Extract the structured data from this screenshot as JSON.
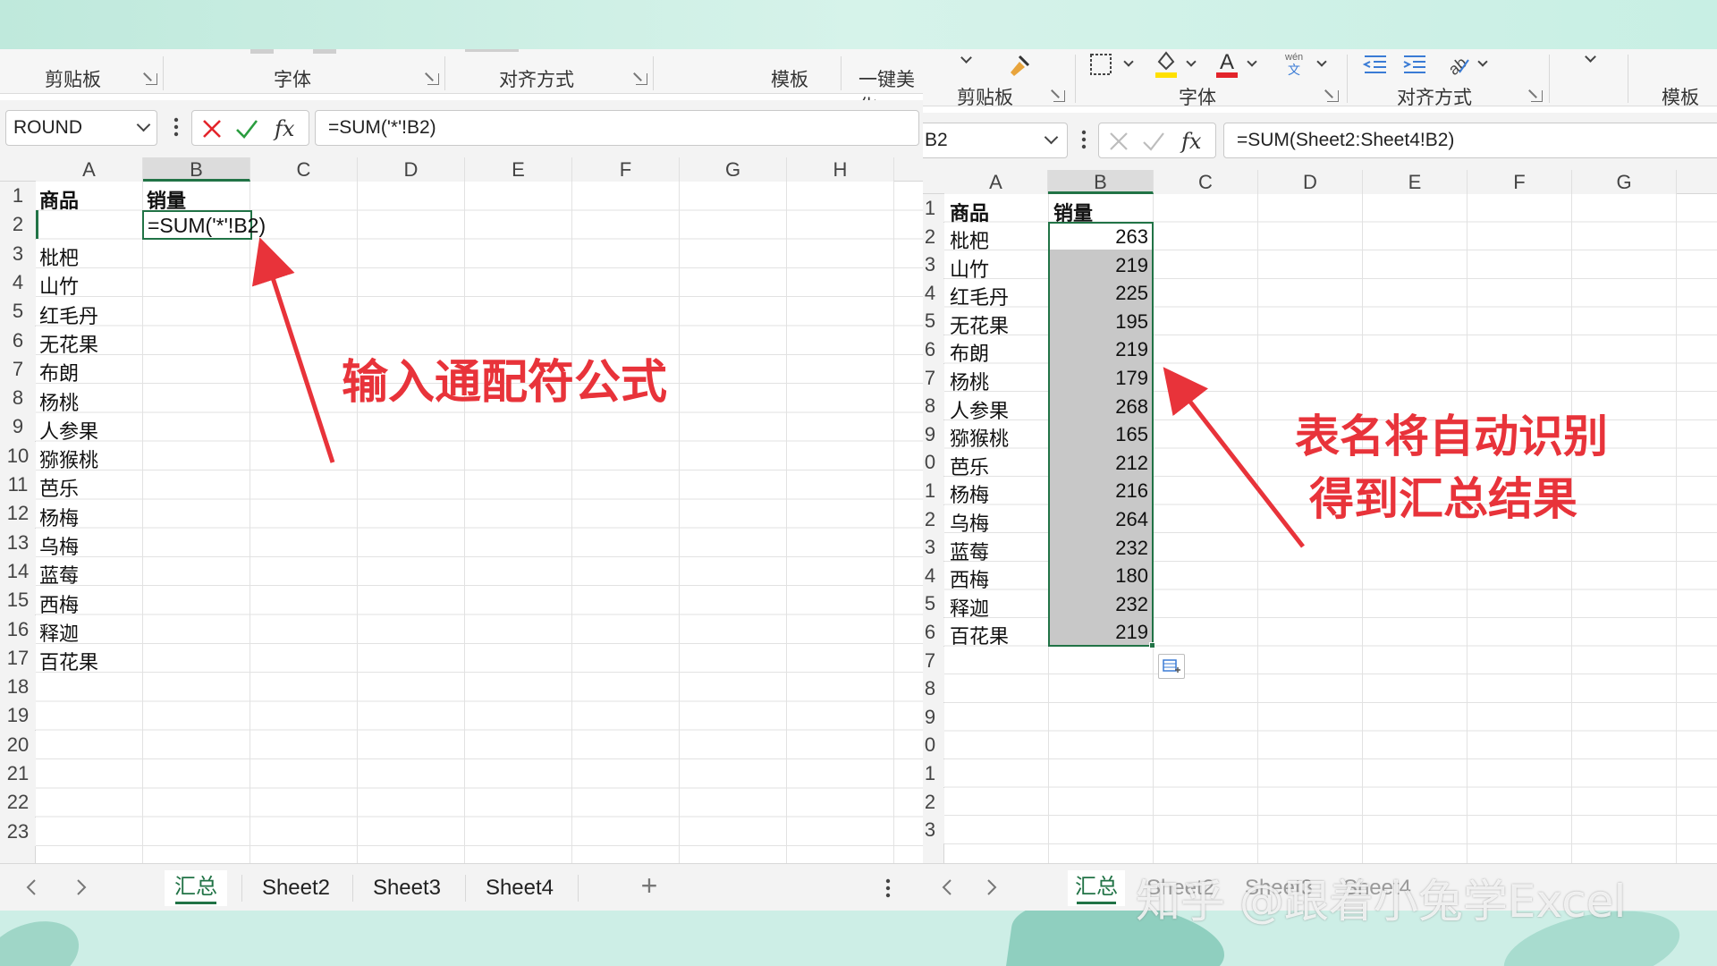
{
  "colors": {
    "accent_green": "#217346",
    "annotation_red": "#e8333a",
    "selection_gray": "#c8c8c8",
    "font_red": "#e3242b",
    "fill_yellow": "#ffe000"
  },
  "left": {
    "ribbon_groups": [
      "剪贴板",
      "字体",
      "对齐方式",
      "模板",
      "一键美化"
    ],
    "name_box": "ROUND",
    "formula": "=SUM('*'!B2)",
    "columns": [
      "A",
      "B",
      "C",
      "D",
      "E",
      "F",
      "G",
      "H"
    ],
    "rows": [
      "1",
      "2",
      "3",
      "4",
      "5",
      "6",
      "7",
      "8",
      "9",
      "10",
      "11",
      "12",
      "13",
      "14",
      "15",
      "16",
      "17",
      "18",
      "19",
      "20",
      "21",
      "22",
      "23"
    ],
    "header": {
      "a": "商品",
      "b": "销量"
    },
    "editing_cell": "=SUM('*'!B2)",
    "products": [
      "枇杷",
      "山竹",
      "红毛丹",
      "无花果",
      "布朗",
      "杨桃",
      "人参果",
      "猕猴桃",
      "芭乐",
      "杨梅",
      "乌梅",
      "蓝莓",
      "西梅",
      "释迦",
      "百花果"
    ],
    "tabs": [
      "汇总",
      "Sheet2",
      "Sheet3",
      "Sheet4"
    ],
    "add_tab": "+",
    "annotation": "输入通配符公式"
  },
  "right": {
    "ribbon_groups": [
      "剪贴板",
      "字体",
      "对齐方式",
      "模板"
    ],
    "name_box": "B2",
    "formula": "=SUM(Sheet2:Sheet4!B2)",
    "columns": [
      "A",
      "B",
      "C",
      "D",
      "E",
      "F",
      "G"
    ],
    "rows": [
      "1",
      "2",
      "3",
      "4",
      "5",
      "6",
      "7",
      "8",
      "9",
      "0",
      "1",
      "2",
      "3",
      "4",
      "5",
      "6",
      "7",
      "8",
      "9",
      "0",
      "1",
      "2",
      "3"
    ],
    "header": {
      "a": "商品",
      "b": "销量"
    },
    "products": [
      "枇杷",
      "山竹",
      "红毛丹",
      "无花果",
      "布朗",
      "杨桃",
      "人参果",
      "猕猴桃",
      "芭乐",
      "杨梅",
      "乌梅",
      "蓝莓",
      "西梅",
      "释迦",
      "百花果"
    ],
    "values": [
      "263",
      "219",
      "225",
      "195",
      "219",
      "179",
      "268",
      "165",
      "212",
      "216",
      "264",
      "232",
      "180",
      "232",
      "219"
    ],
    "tabs": [
      "汇总",
      "Sheet2",
      "Sheet3",
      "Sheet4"
    ],
    "annotation_line1": "表名将自动识别",
    "annotation_line2": "得到汇总结果"
  },
  "watermark": "知乎 @跟着小兔学Excel",
  "icons": [
    "paste-brush-icon",
    "border-icon",
    "fill-color-icon",
    "font-color-icon",
    "phonetic-icon",
    "decrease-indent-icon",
    "increase-indent-icon",
    "text-orientation-icon",
    "cancel-icon",
    "enter-icon",
    "fx-icon",
    "paste-options-icon",
    "more-icon"
  ]
}
